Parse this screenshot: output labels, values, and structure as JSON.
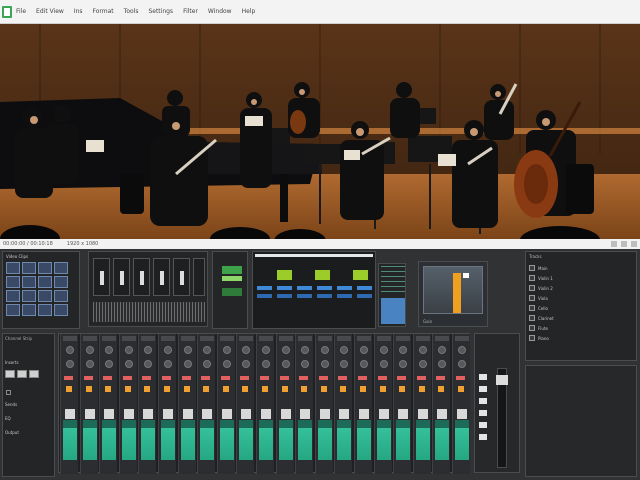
{
  "app": {
    "title": "",
    "accent": "#2f9e44"
  },
  "menu": {
    "items": [
      "File",
      "Edit View",
      "Ins",
      "Format",
      "Tools",
      "Settings",
      "Filter",
      "Window",
      "Help"
    ]
  },
  "video": {
    "description_free": true
  },
  "video_strip": {
    "left_text": "00:00:00 / 00:10:18",
    "right_text": "1920 x 1080"
  },
  "panels": {
    "thumbs": {
      "title": "Video Clips",
      "count": 16
    },
    "faders": {
      "channels": 6
    },
    "mixer": {
      "rows": 3,
      "cols": 6
    },
    "slider": {
      "label": "Gain",
      "value_fraction": 0.55
    },
    "track_list": {
      "header": "Tracks",
      "items": [
        "Main",
        "Violin 1",
        "Violin 2",
        "Viola",
        "Cello",
        "Clarinet",
        "Flute",
        "Piano"
      ]
    },
    "left": {
      "header": "Channel Strip",
      "sections": [
        "Inserts",
        "Sends",
        "EQ",
        "Output"
      ]
    }
  },
  "mixer_strips": {
    "count": 21
  },
  "icons": [
    "app-icon",
    "play-icon",
    "stop-icon",
    "record-icon",
    "settings-icon"
  ]
}
